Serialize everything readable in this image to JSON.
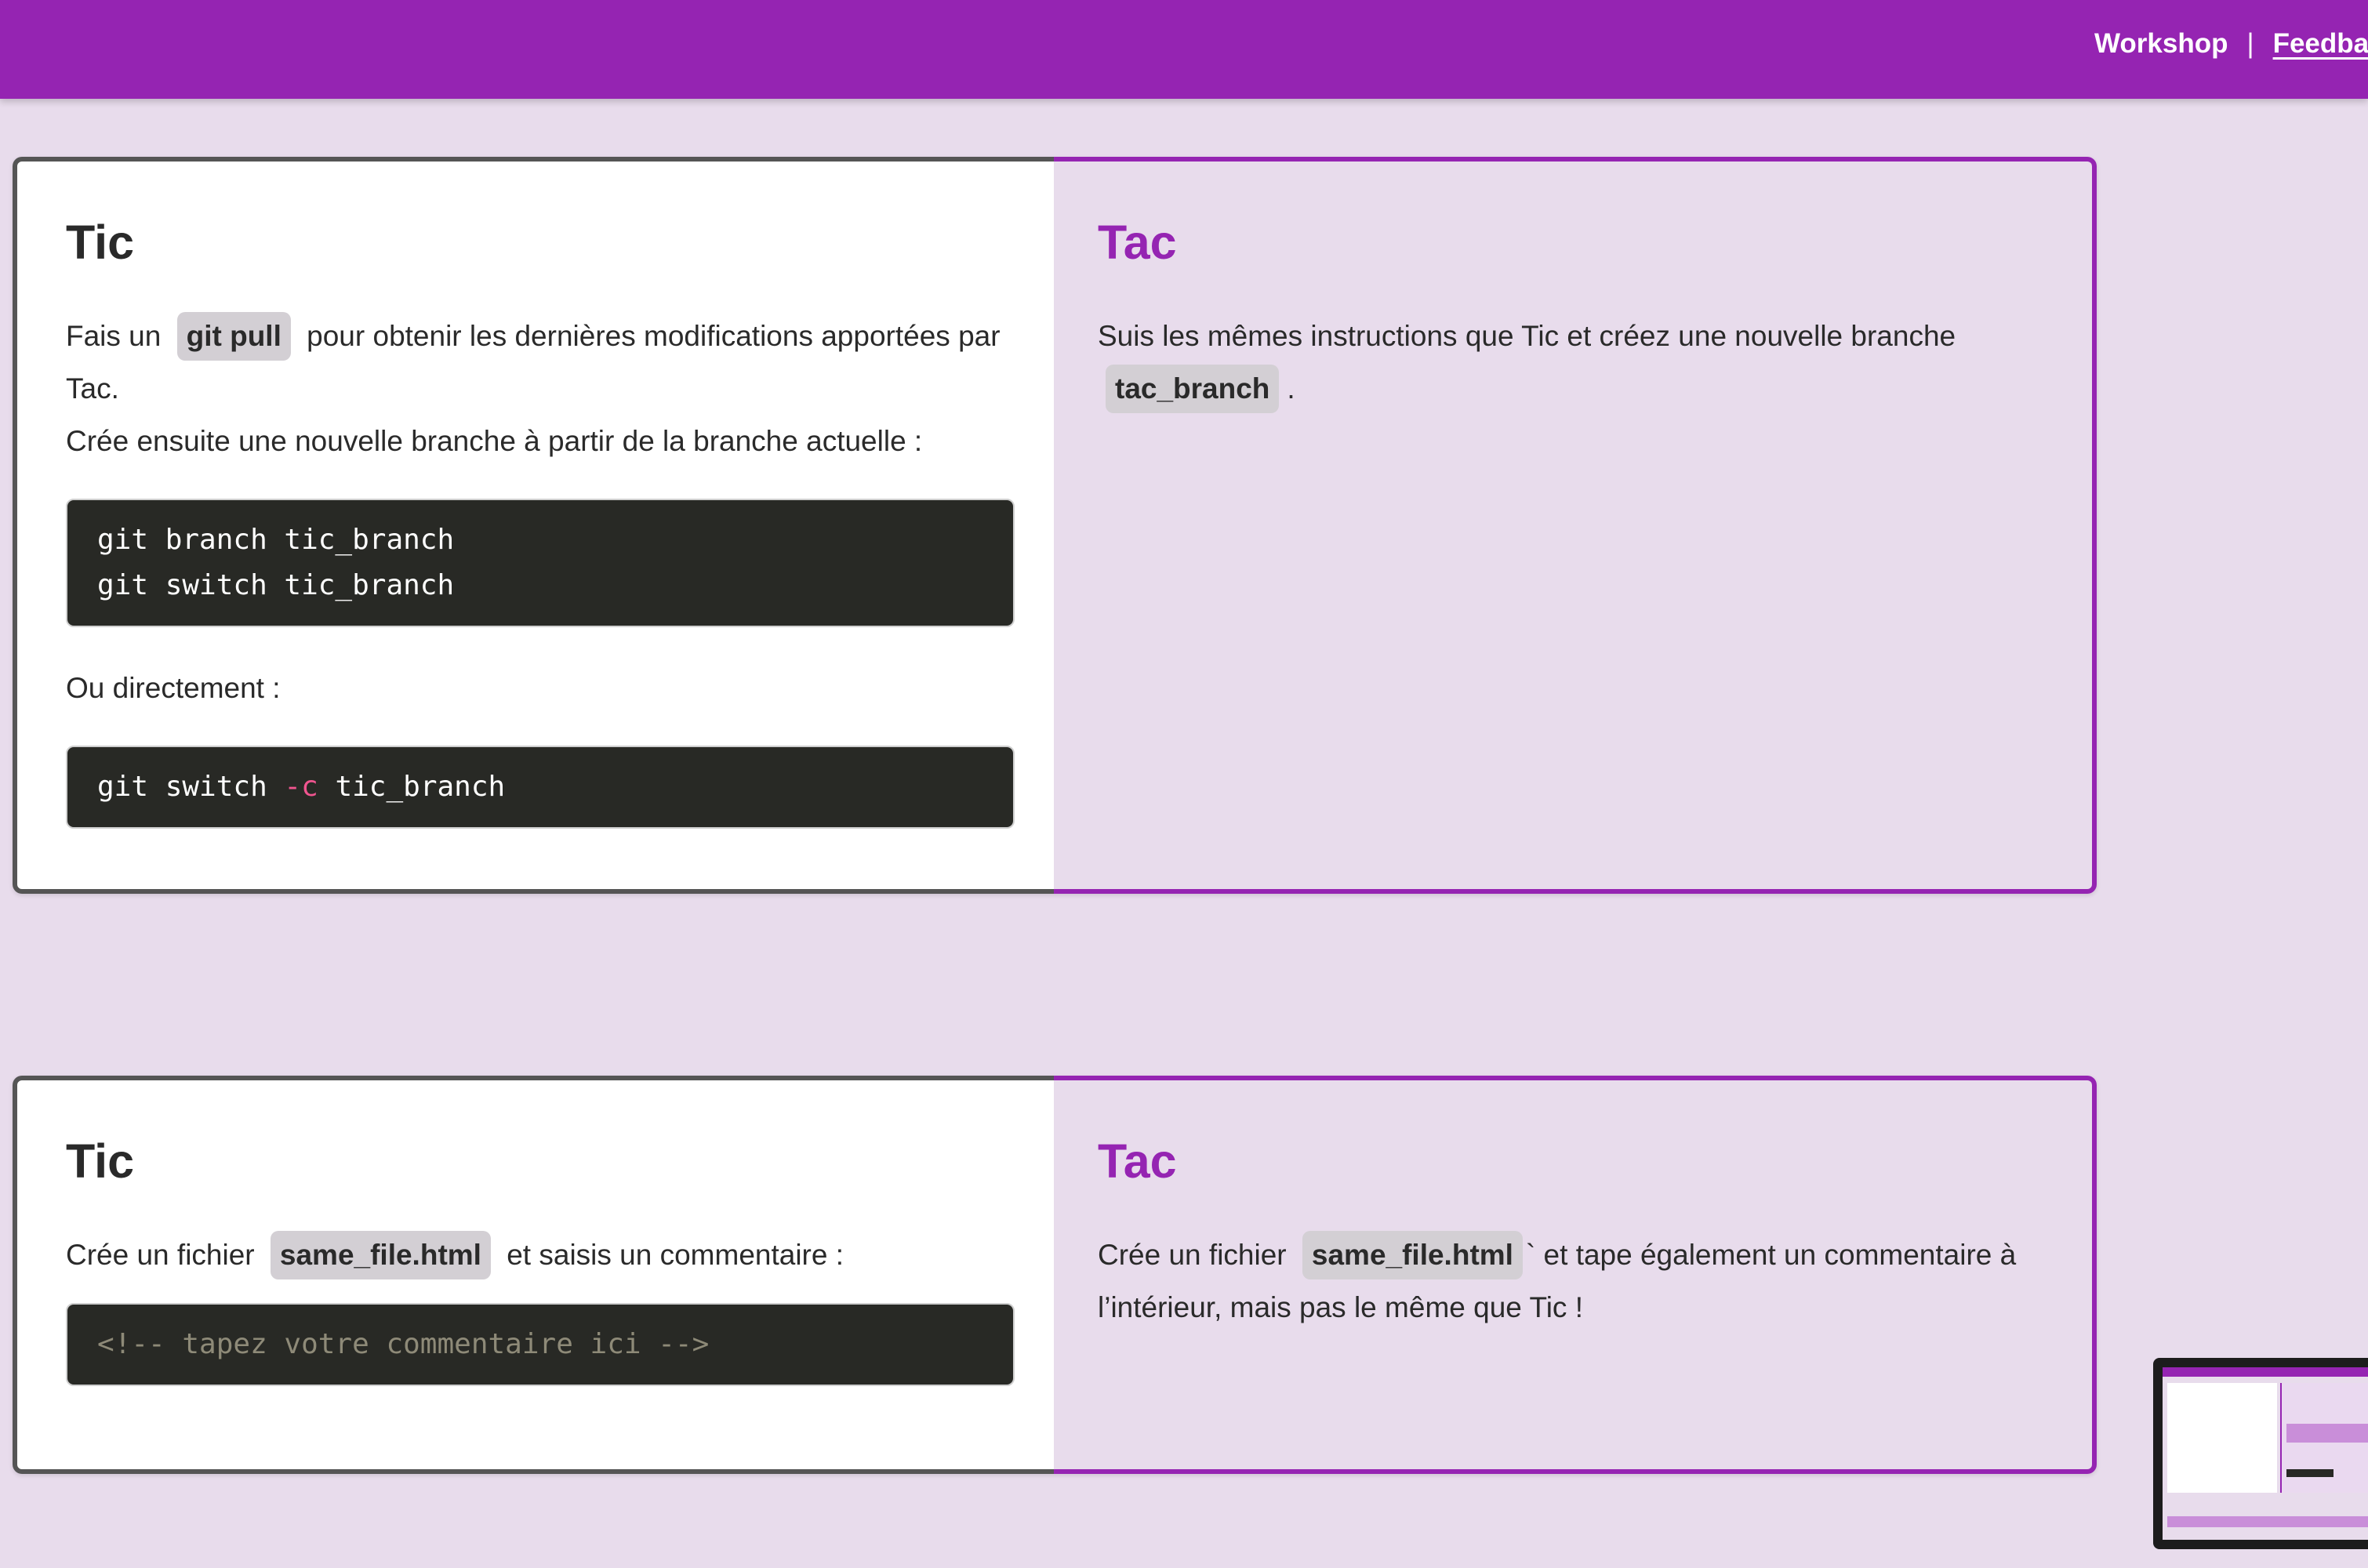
{
  "header": {
    "nav_workshop": "Workshop",
    "nav_separator": "|",
    "nav_feedback": "Feedba"
  },
  "colors": {
    "brand_purple": "#9524b2",
    "page_background": "#e8dcec",
    "code_background": "#282925",
    "code_flag": "#f0558f",
    "code_comment": "#8e8a78"
  },
  "step1": {
    "tic": {
      "title": "Tic",
      "intro_before": "Fais un",
      "intro_code": "git pull",
      "intro_after": "pour obtenir les dernières modifications apportées par Tac.",
      "instruction": "Crée ensuite une nouvelle branche à partir de la branche actuelle :",
      "code1_line1": "git branch tic_branch",
      "code1_line2": "git switch tic_branch",
      "alternative": "Ou directement :",
      "code2_cmd": "git switch ",
      "code2_flag": "-c",
      "code2_arg": " tic_branch"
    },
    "tac": {
      "title": "Tac",
      "text_before": "Suis les mêmes instructions que Tic et créez une nouvelle branche",
      "text_code": "tac_branch",
      "text_after": "."
    }
  },
  "step2": {
    "tic": {
      "title": "Tic",
      "text_before": "Crée un fichier",
      "text_code": "same_file.html",
      "text_after": "et saisis un commentaire :",
      "code_comment": "<!-- tapez votre commentaire ici -->"
    },
    "tac": {
      "title": "Tac",
      "text_before": "Crée un fichier",
      "text_code": "same_file.html",
      "text_after": "` et tape également un commentaire à l’intérieur, mais pas le même que Tic !"
    }
  },
  "thumbnail": {
    "icon": "page-preview-thumbnail"
  }
}
